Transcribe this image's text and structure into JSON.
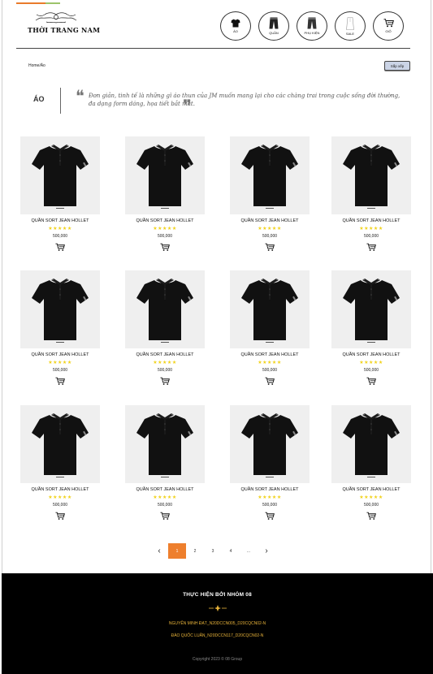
{
  "header": {
    "logo_text": "THỜI TRANG NAM",
    "categories": [
      {
        "label": "ÁO",
        "icon": "shirt-icon"
      },
      {
        "label": "QUẦN",
        "icon": "pants-icon"
      },
      {
        "label": "PHỤ KIỆN",
        "icon": "accessory-pants-icon"
      },
      {
        "label": "SALE",
        "icon": "sale-shirt-icon"
      },
      {
        "label": "GIỎ",
        "icon": "cart-icon"
      }
    ]
  },
  "breadcrumb": "Home/Áo",
  "sort_label": "Sắp xếp",
  "intro": {
    "title": "ÁO",
    "quote_open": "❝",
    "quote_close": "❞",
    "text": "Đơn giản, tinh tế là những gì áo thun của JM muốn mang lại cho các chàng trai trong cuộc sống đời thường, đa dạng form dáng, họa tiết bắt mắt."
  },
  "products": [
    {
      "name": "QUẦN SORT JEAN HOLLET",
      "stars": "★★★★★",
      "price": "500,000"
    },
    {
      "name": "QUẦN SORT JEAN HOLLET",
      "stars": "★★★★★",
      "price": "500,000"
    },
    {
      "name": "QUẦN SORT JEAN HOLLET",
      "stars": "★★★★★",
      "price": "500,000"
    },
    {
      "name": "QUẦN SORT JEAN HOLLET",
      "stars": "★★★★★",
      "price": "500,000"
    },
    {
      "name": "QUẦN SORT JEAN HOLLET",
      "stars": "★★★★★",
      "price": "500,000"
    },
    {
      "name": "QUẦN SORT JEAN HOLLET",
      "stars": "★★★★★",
      "price": "500,000"
    },
    {
      "name": "QUẦN SORT JEAN HOLLET",
      "stars": "★★★★★",
      "price": "500,000"
    },
    {
      "name": "QUẦN SORT JEAN HOLLET",
      "stars": "★★★★★",
      "price": "500,000"
    },
    {
      "name": "QUẦN SORT JEAN HOLLET",
      "stars": "★★★★★",
      "price": "500,000"
    },
    {
      "name": "QUẦN SORT JEAN HOLLET",
      "stars": "★★★★★",
      "price": "500,000"
    },
    {
      "name": "QUẦN SORT JEAN HOLLET",
      "stars": "★★★★★",
      "price": "500,000"
    },
    {
      "name": "QUẦN SORT JEAN HOLLET",
      "stars": "★★★★★",
      "price": "500,000"
    }
  ],
  "pagination": {
    "prev": "‹",
    "pages": [
      "1",
      "2",
      "3",
      "4",
      "..."
    ],
    "current": "1",
    "next": "›"
  },
  "footer": {
    "title": "THỰC HIỆN BỞI NHÓM 08",
    "members": [
      "NGUYỄN MINH ĐẠT_N20DCCN005_D20CQCN02-N",
      "ĐÀO QUỐC LUÂN_N20DCCN117_D20CQCN02-N"
    ],
    "copyright": "Copyright 2023 © 08 Group"
  },
  "colors": {
    "accent": "#ee7f2d",
    "stars": "#f1d21a",
    "footer_bg": "#000000",
    "footer_member": "#e8b33a",
    "sort_button": "#cbd4e6"
  }
}
